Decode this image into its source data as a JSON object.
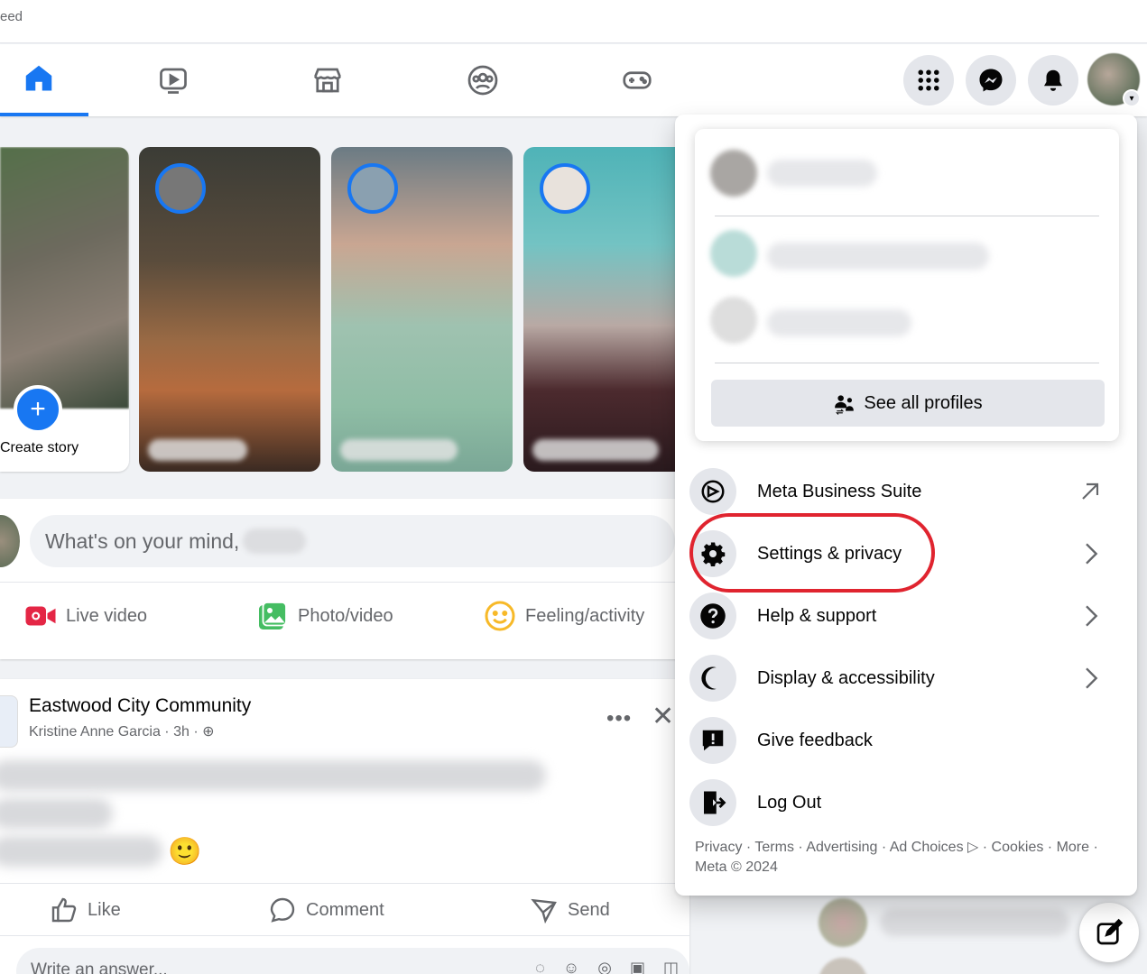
{
  "window": {
    "title_fragment": "eed"
  },
  "nav": {
    "tabs": [
      {
        "name": "home",
        "active": true
      },
      {
        "name": "watch",
        "active": false
      },
      {
        "name": "marketplace",
        "active": false
      },
      {
        "name": "groups",
        "active": false
      },
      {
        "name": "gaming",
        "active": false
      }
    ],
    "right_buttons": [
      "menu-grid",
      "messenger",
      "notifications",
      "account"
    ]
  },
  "stories": {
    "create_label": "Create story",
    "create_plus": "+"
  },
  "composer": {
    "placeholder": "What's on your mind,",
    "actions": [
      {
        "label": "Live video",
        "icon": "live-video-icon"
      },
      {
        "label": "Photo/video",
        "icon": "photo-icon"
      },
      {
        "label": "Feeling/activity",
        "icon": "feeling-icon"
      }
    ]
  },
  "post": {
    "group": "Eastwood City Community",
    "author_meta": "Kristine Anne Garcia · 3h ·",
    "more": "•••",
    "close": "✕",
    "emoji": "🙂",
    "reactions": {
      "like": "Like",
      "comment": "Comment",
      "send": "Send"
    },
    "answer_placeholder": "Write an answer..."
  },
  "menu": {
    "see_all_profiles": "See all profiles",
    "items": [
      {
        "label": "Meta Business Suite",
        "icon": "meta-business-icon",
        "trailing": "external"
      },
      {
        "label": "Settings & privacy",
        "icon": "gear-icon",
        "trailing": "chevron",
        "highlighted": true
      },
      {
        "label": "Help & support",
        "icon": "question-icon",
        "trailing": "chevron"
      },
      {
        "label": "Display & accessibility",
        "icon": "moon-icon",
        "trailing": "chevron"
      },
      {
        "label": "Give feedback",
        "icon": "feedback-icon",
        "trailing": "none"
      },
      {
        "label": "Log Out",
        "icon": "logout-icon",
        "trailing": "none"
      }
    ],
    "footer_line1": "Privacy · Terms · Advertising · Ad Choices ▷ · Cookies · More ·",
    "footer_line2": "Meta © 2024"
  },
  "colors": {
    "brand": "#1877f2",
    "highlight_ring": "#e0242f",
    "page_bg": "#f0f2f5"
  }
}
